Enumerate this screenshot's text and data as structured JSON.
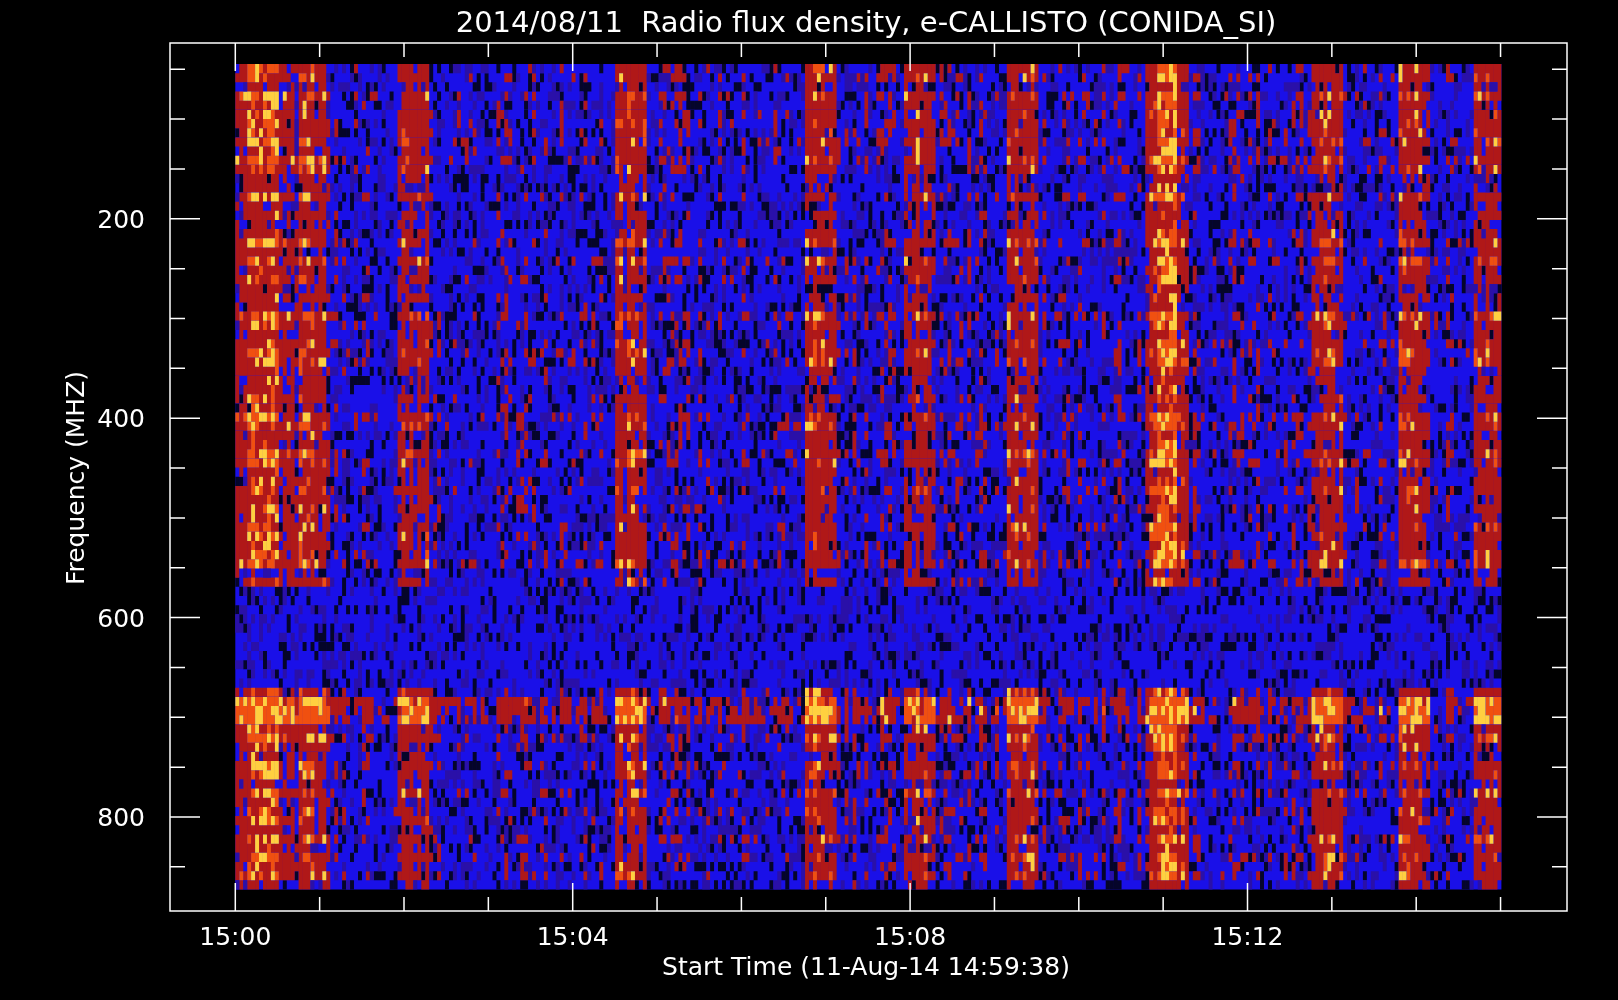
{
  "plot": {
    "title": "2014/08/11  Radio flux density, e-CALLISTO (CONIDA_SI)",
    "xlabel": "Start Time (11-Aug-14 14:59:38)",
    "ylabel": "Frequency (MHZ)",
    "xticks": [
      "15:00",
      "15:04",
      "15:08",
      "15:12"
    ],
    "yticks": [
      "200",
      "400",
      "600",
      "800"
    ]
  }
}
